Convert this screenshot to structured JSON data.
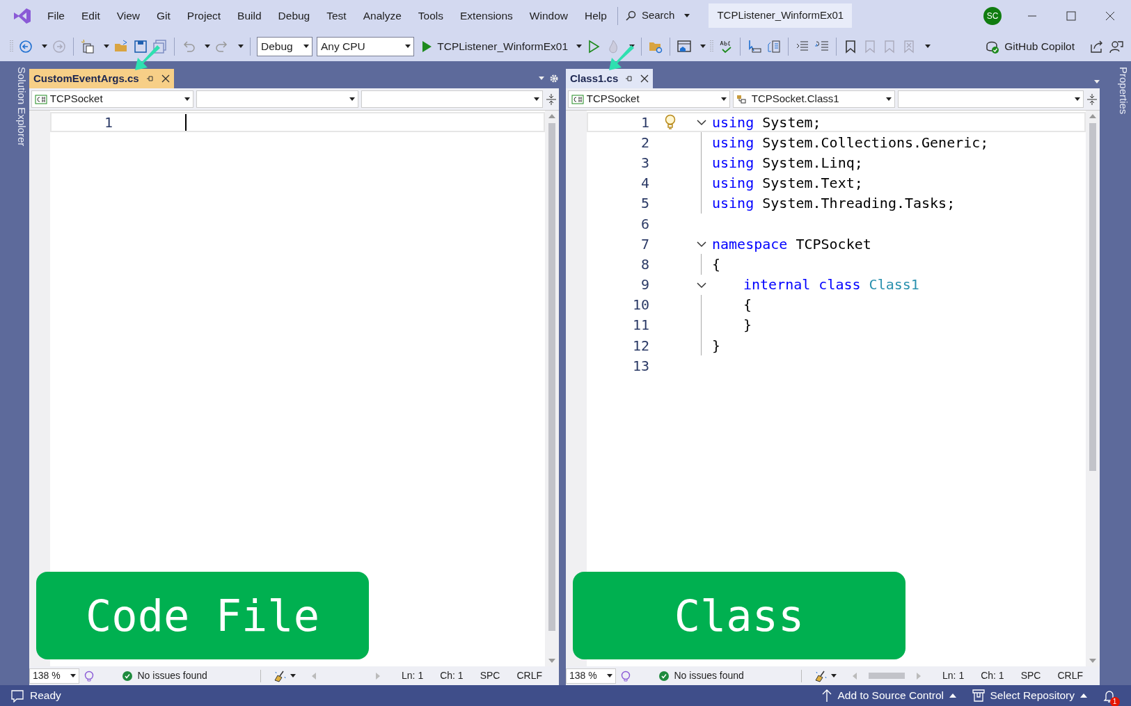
{
  "menu": [
    "File",
    "Edit",
    "View",
    "Git",
    "Project",
    "Build",
    "Debug",
    "Test",
    "Analyze",
    "Tools",
    "Extensions",
    "Window",
    "Help"
  ],
  "search": {
    "label": "Search"
  },
  "solution_title": "TCPListener_WinformEx01",
  "avatar": "SC",
  "toolbar": {
    "configuration": "Debug",
    "platform": "Any CPU",
    "startup": "TCPListener_WinformEx01",
    "copilot": "GitHub Copilot"
  },
  "side_tabs": {
    "left": "Solution Explorer",
    "right": "Properties"
  },
  "editors": [
    {
      "tab": {
        "label": "CustomEventArgs.cs",
        "selected": true
      },
      "nav": {
        "project": "TCPSocket"
      },
      "lines": [
        {
          "number": "1",
          "current": true
        }
      ],
      "zoom": "138 %",
      "issues": "No issues found",
      "ln": "Ln: 1",
      "ch": "Ch: 1",
      "spaces": "SPC",
      "line_end": "CRLF",
      "annotation": "Code File"
    },
    {
      "tab": {
        "label": "Class1.cs",
        "selected": false
      },
      "nav": {
        "project": "TCPSocket",
        "type": "TCPSocket.Class1"
      },
      "lines": [
        {
          "number": "1",
          "current": true,
          "bulb": true,
          "collapsible": true,
          "tokens": [
            {
              "kind": "keyword",
              "text": "using"
            },
            {
              "kind": "plain",
              "text": " System;"
            }
          ]
        },
        {
          "number": "2",
          "outlined": true,
          "tokens": [
            {
              "kind": "keyword",
              "text": "using"
            },
            {
              "kind": "plain",
              "text": " System.Collections.Generic;"
            }
          ]
        },
        {
          "number": "3",
          "outlined": true,
          "tokens": [
            {
              "kind": "keyword",
              "text": "using"
            },
            {
              "kind": "plain",
              "text": " System.Linq;"
            }
          ]
        },
        {
          "number": "4",
          "outlined": true,
          "tokens": [
            {
              "kind": "keyword",
              "text": "using"
            },
            {
              "kind": "plain",
              "text": " System.Text;"
            }
          ]
        },
        {
          "number": "5",
          "outlined": true,
          "tokens": [
            {
              "kind": "keyword",
              "text": "using"
            },
            {
              "kind": "plain",
              "text": " System.Threading.Tasks;"
            }
          ]
        },
        {
          "number": "6"
        },
        {
          "number": "7",
          "collapsible": true,
          "tokens": [
            {
              "kind": "keyword",
              "text": "namespace"
            },
            {
              "kind": "plain",
              "text": " TCPSocket"
            }
          ]
        },
        {
          "number": "8",
          "outlined": true,
          "tokens": [
            {
              "kind": "plain",
              "text": "{"
            }
          ]
        },
        {
          "number": "9",
          "collapsible": true,
          "indent": true,
          "tokens": [
            {
              "kind": "keyword",
              "text": "internal"
            },
            {
              "kind": "keyword",
              "text": " class"
            },
            {
              "kind": "type",
              "text": " Class1"
            }
          ]
        },
        {
          "number": "10",
          "outlined": true,
          "indent": true,
          "tokens": [
            {
              "kind": "plain",
              "text": "{"
            }
          ]
        },
        {
          "number": "11",
          "outlined": true,
          "indent": true,
          "tokens": [
            {
              "kind": "plain",
              "text": "}"
            }
          ]
        },
        {
          "number": "12",
          "outlined": true,
          "tokens": [
            {
              "kind": "plain",
              "text": "}"
            }
          ]
        },
        {
          "number": "13"
        }
      ],
      "zoom": "138 %",
      "issues": "No issues found",
      "ln": "Ln: 1",
      "ch": "Ch: 1",
      "spaces": "SPC",
      "line_end": "CRLF",
      "annotation": "Class"
    }
  ],
  "status": {
    "ready": "Ready",
    "source_control": "Add to Source Control",
    "repository": "Select Repository",
    "notifications": "1"
  }
}
